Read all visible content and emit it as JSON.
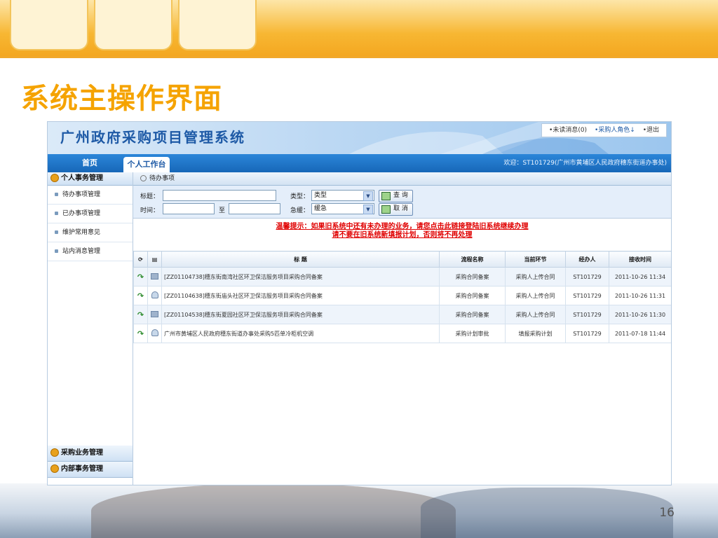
{
  "slide": {
    "title": "系统主操作界面",
    "page_number": "16"
  },
  "app": {
    "title": "广州政府采购项目管理系统",
    "header_links": [
      "•未读消息(0)",
      "•采购人角色↓",
      "•退出"
    ],
    "nav": {
      "home": "首页",
      "workspace": "个人工作台"
    },
    "welcome": "欢迎：ST101729(广州市黄埔区人民政府穗东街道办事处)"
  },
  "sidebar": {
    "section_personal": "个人事务管理",
    "items": [
      "待办事项管理",
      "已办事项管理",
      "维护常用意见",
      "站内消息管理"
    ],
    "section_purchase": "采购业务管理",
    "section_internal": "内部事务管理"
  },
  "content": {
    "panel_title": "待办事项",
    "search": {
      "title_label": "标题：",
      "type_label": "类型：",
      "type_value": "类型",
      "query_button": "查 询",
      "time_label": "时间：",
      "to_label": "至",
      "urgency_label": "急缓：",
      "urgency_value": "缓急",
      "cancel_button": "取 消"
    },
    "notice_line1": "温馨提示：如果旧系统中还有未办理的业务，请您点击此链接登陆旧系统继续办理",
    "notice_line2": "请不要在旧系统新填报计划，否则将不再处理",
    "table": {
      "headers": [
        "标 题",
        "流程名称",
        "当前环节",
        "经办人",
        "接收时间"
      ],
      "rows": [
        {
          "title": "[ZZ01104738]穗东街南湾社区环卫保洁服务项目采购合同备案",
          "process": "采购合同备案",
          "step": "采购人上传合同",
          "handler": "ST101729",
          "time": "2011-10-26 11:34"
        },
        {
          "title": "[ZZ01104638]穗东街庙头社区环卫保洁服务项目采购合同备案",
          "process": "采购合同备案",
          "step": "采购人上传合同",
          "handler": "ST101729",
          "time": "2011-10-26 11:31"
        },
        {
          "title": "[ZZ01104538]穗东街夏园社区环卫保洁服务项目采购合同备案",
          "process": "采购合同备案",
          "step": "采购人上传合同",
          "handler": "ST101729",
          "time": "2011-10-26 11:30"
        },
        {
          "title": "广州市黄埔区人民政府穗东街道办事处采购5匹单冷柜机空调",
          "process": "采购计划审批",
          "step": "填报采购计划",
          "handler": "ST101729",
          "time": "2011-07-18 11:44"
        }
      ]
    }
  }
}
